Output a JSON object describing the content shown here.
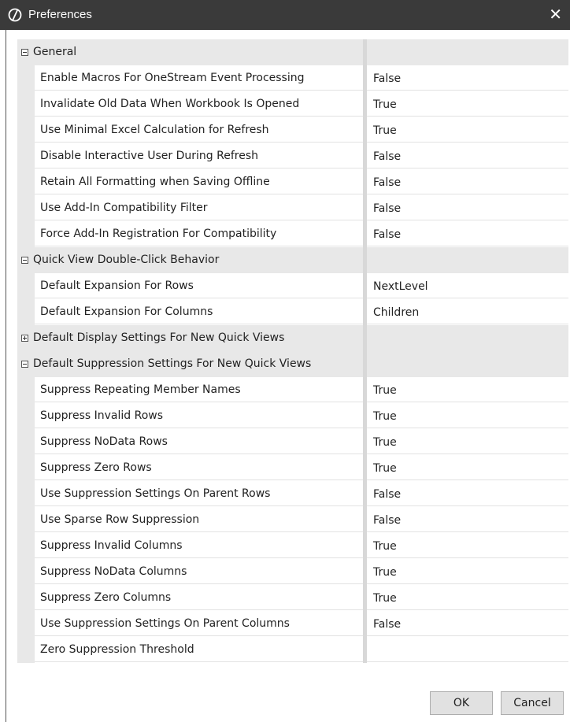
{
  "window": {
    "title": "Preferences",
    "close_glyph": "✕"
  },
  "sections": [
    {
      "label": "General",
      "expanded": true,
      "items": [
        {
          "name": "Enable Macros For OneStream Event Processing",
          "value": "False"
        },
        {
          "name": "Invalidate Old Data When Workbook Is Opened",
          "value": "True"
        },
        {
          "name": "Use Minimal Excel Calculation for Refresh",
          "value": "True"
        },
        {
          "name": "Disable Interactive User During Refresh",
          "value": "False"
        },
        {
          "name": "Retain All Formatting when Saving Offline",
          "value": "False"
        },
        {
          "name": "Use Add-In Compatibility Filter",
          "value": "False"
        },
        {
          "name": "Force Add-In Registration For Compatibility",
          "value": "False"
        }
      ]
    },
    {
      "label": "Quick View Double-Click Behavior",
      "expanded": true,
      "items": [
        {
          "name": "Default Expansion For Rows",
          "value": "NextLevel"
        },
        {
          "name": "Default Expansion For Columns",
          "value": "Children"
        }
      ]
    },
    {
      "label": "Default Display Settings For New Quick Views",
      "expanded": false,
      "items": []
    },
    {
      "label": "Default Suppression Settings For New Quick Views",
      "expanded": true,
      "items": [
        {
          "name": "Suppress Repeating Member Names",
          "value": "True"
        },
        {
          "name": "Suppress Invalid Rows",
          "value": "True"
        },
        {
          "name": "Suppress NoData Rows",
          "value": "True"
        },
        {
          "name": "Suppress Zero Rows",
          "value": "True"
        },
        {
          "name": "Use Suppression Settings On Parent Rows",
          "value": "False"
        },
        {
          "name": "Use Sparse Row Suppression",
          "value": "False"
        },
        {
          "name": "Suppress Invalid Columns",
          "value": "True"
        },
        {
          "name": "Suppress NoData Columns",
          "value": "True"
        },
        {
          "name": "Suppress Zero Columns",
          "value": "True"
        },
        {
          "name": "Use Suppression Settings On Parent Columns",
          "value": "False"
        },
        {
          "name": "Zero Suppression Threshold",
          "value": ""
        }
      ]
    }
  ],
  "buttons": {
    "ok": "OK",
    "cancel": "Cancel"
  }
}
